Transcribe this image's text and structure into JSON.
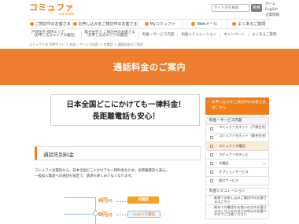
{
  "brand": {
    "logo": "コミュファ",
    "tagline": "commufa",
    "accent": "#ef7d1a",
    "hero_color": "#ee7e2e"
  },
  "search": {
    "placeholder": "サイト内を検索",
    "button": "検索"
  },
  "util_links": [
    "ホーム",
    "English",
    "企業情報"
  ],
  "nav": [
    {
      "label": "ご検討中のお客さま",
      "icon": "circle-icon"
    },
    {
      "label": "お申し込みをご検討中のお客さま",
      "icon": "circle-icon"
    },
    {
      "label": "Myコミュファ",
      "icon": "circle-icon"
    },
    {
      "label": "Webメール",
      "icon": "circle-icon"
    },
    {
      "label": "よくあるご質問",
      "icon": "circle-icon"
    }
  ],
  "subnav": [
    {
      "line1": "戸建住宅 提供エリア",
      "line2": "（お申し込みエリアの確認）"
    },
    {
      "line1": "集合住宅で ご検討中のお客さま",
      "line2": "（お申し込みエリアの確認）"
    },
    {
      "line1": "料金・サービス内容"
    },
    {
      "line1": "料金シミュレーション"
    },
    {
      "line1": "キャンペーン"
    },
    {
      "line1": "よくあるご質問"
    }
  ],
  "breadcrumb": "コミュファ光 TOPサイト ＞ 料金・サービス内容 ＞ 光電話 ＞ 通話料金のご案内",
  "page_title": "通話料金のご案内",
  "headline": {
    "line1": "日本全国どこにかけても一律料金！",
    "line2": "長距離電話も安心！"
  },
  "section_title": "通話先別料金",
  "body_text": {
    "line1": "コミュファ光電話なら、日本全国どこにかけても一律料金なため、長距離電話も安心。",
    "line2": "一般加入電話への通話も低定で、請求も楽しみ少なくなります。"
  },
  "diagram": {
    "price_top": "0円",
    "price_mid": "0円",
    "price_unit": "/月",
    "pill_top": "光電話",
    "pill_mid": "auおうち電話"
  },
  "sidebar": {
    "header": "お申し込みをご検討中のお客さまはこちら",
    "category": "料金・サービス内容",
    "sub_items": [
      {
        "label": "コミュファ光ネット（戸建住宅）",
        "active": false,
        "ext": false,
        "two": true
      },
      {
        "label": "コミュファ光ネット（集合住宅）",
        "active": false,
        "ext": false,
        "two": true
      },
      {
        "label": "コミュファ光電話",
        "active": true,
        "ext": false,
        "two": false
      },
      {
        "label": "コミュファ光テレビ",
        "active": false,
        "ext": false,
        "two": false
      },
      {
        "label": "光電話",
        "active": false,
        "ext": true,
        "two": false
      },
      {
        "label": "オプションサービス",
        "active": false,
        "ext": false,
        "two": false
      },
      {
        "label": "割引サービス",
        "active": false,
        "ext": false,
        "two": false
      }
    ],
    "category2": "料金シミュレーション",
    "items": [
      {
        "label": "新規でお申し込みご検討中のお客さまはこちら",
        "tall": false
      },
      {
        "label": "既存で光電話をお使いの方のお客さまはこちらの方法でお申込が必要ですのでご注意ください",
        "tall": true
      }
    ]
  }
}
